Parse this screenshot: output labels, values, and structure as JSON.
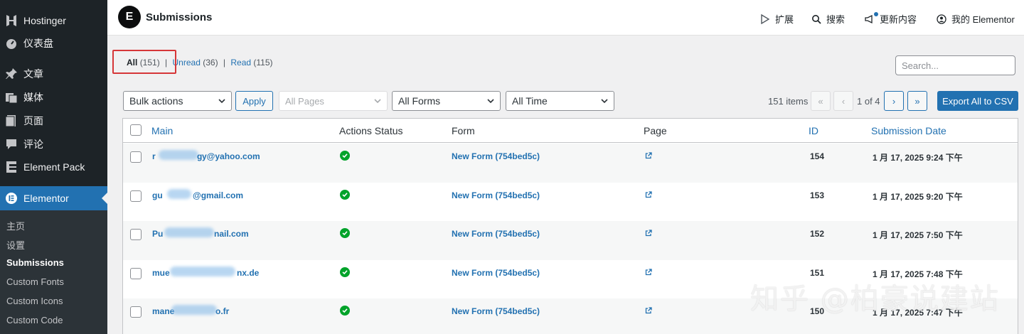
{
  "sidebar": {
    "items": [
      {
        "label": "Hostinger",
        "icon": "hostinger-icon"
      },
      {
        "label": "仪表盘",
        "icon": "dashboard-icon"
      },
      {
        "label": "文章",
        "icon": "pin-icon"
      },
      {
        "label": "媒体",
        "icon": "media-icon"
      },
      {
        "label": "页面",
        "icon": "page-icon"
      },
      {
        "label": "评论",
        "icon": "comment-icon"
      },
      {
        "label": "Element Pack",
        "icon": "element-pack-icon"
      },
      {
        "label": "Elementor",
        "icon": "elementor-icon"
      }
    ],
    "submenu": [
      "主页",
      "设置",
      "Submissions",
      "Custom Fonts",
      "Custom Icons",
      "Custom Code"
    ],
    "current_submenu": "Submissions"
  },
  "header": {
    "logo_text": "E",
    "title": "Submissions",
    "links": [
      "扩展",
      "搜索",
      "更新内容",
      "我的 Elementor"
    ]
  },
  "filters": {
    "all_label": "All",
    "all_count": "(151)",
    "sep": "|",
    "unread_label": "Unread",
    "unread_count": "(36)",
    "read_label": "Read",
    "read_count": "(115)"
  },
  "search": {
    "placeholder": "Search..."
  },
  "toolbar": {
    "bulk_actions": "Bulk actions",
    "apply": "Apply",
    "all_pages": "All Pages",
    "all_forms": "All Forms",
    "all_time": "All Time",
    "items_count": "151 items",
    "first": "«",
    "prev": "‹",
    "page_text": "1 of 4",
    "next": "›",
    "last": "»",
    "export": "Export All to CSV"
  },
  "table": {
    "columns": [
      "Main",
      "Actions Status",
      "Form",
      "Page",
      "ID",
      "Submission Date"
    ],
    "rows": [
      {
        "main_start": "r",
        "main_end": "y@yahoo.com",
        "mid": "g",
        "form": "New Form (754bed5c)",
        "id": "154",
        "date": "1 月 17, 2025 9:24 下午"
      },
      {
        "main_start": "gu",
        "main_end": "@gmail.com",
        "mid": "",
        "form": "New Form (754bed5c)",
        "id": "153",
        "date": "1 月 17, 2025 9:20 下午"
      },
      {
        "main_start": "Pu",
        "main_end": "nail.com",
        "mid": "",
        "form": "New Form (754bed5c)",
        "id": "152",
        "date": "1 月 17, 2025 7:50 下午"
      },
      {
        "main_start": "mue",
        "main_end": "nx.de",
        "mid": "",
        "form": "New Form (754bed5c)",
        "id": "151",
        "date": "1 月 17, 2025 7:48 下午"
      },
      {
        "main_start": "mane",
        "main_end": "o.fr",
        "mid": "",
        "form": "New Form (754bed5c)",
        "id": "150",
        "date": "1 月 17, 2025 7:47 下午"
      }
    ]
  },
  "watermark": "知乎 @柏豪说建站",
  "colors": {
    "accent": "#2271b1",
    "sidebar": "#1d2327",
    "active": "#2271b1",
    "success": "#00a32a",
    "highlight": "#d63638"
  }
}
